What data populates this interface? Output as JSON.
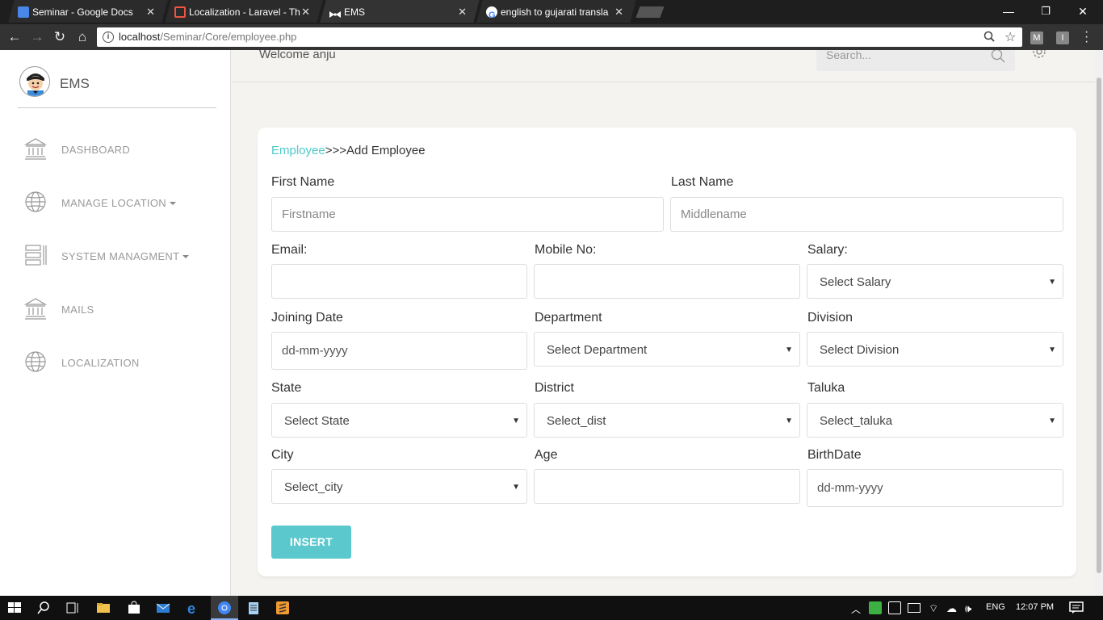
{
  "browser": {
    "tabs": [
      {
        "title": "Seminar - Google Docs",
        "active": false
      },
      {
        "title": "Localization - Laravel - Th",
        "active": false
      },
      {
        "title": "EMS",
        "active": true
      },
      {
        "title": "english to gujarati transla",
        "active": false
      }
    ],
    "url_host": "localhost",
    "url_path": "/Seminar/Core/employee.php",
    "ext1": "M",
    "ext2": "I",
    "min_glyph": "—",
    "max_glyph": "❐",
    "close_glyph": "✕"
  },
  "brand": {
    "name": "EMS"
  },
  "topnav": {
    "welcome": "Welcome anju",
    "search_placeholder": "Search..."
  },
  "sidebar": {
    "items": [
      {
        "label": "DASHBOARD",
        "icon": "bank-icon",
        "has_caret": false
      },
      {
        "label": "MANAGE LOCATION",
        "icon": "globe-icon",
        "has_caret": true
      },
      {
        "label": "SYSTEM MANAGMENT",
        "icon": "list-icon",
        "has_caret": true
      },
      {
        "label": "MAILS",
        "icon": "bank-icon",
        "has_caret": false
      },
      {
        "label": "LOCALIZATION",
        "icon": "globe-icon",
        "has_caret": false
      }
    ]
  },
  "breadcrumb": {
    "link": "Employee",
    "separator": ">>>",
    "current": "Add Employee"
  },
  "form": {
    "first_name": {
      "label": "First Name",
      "placeholder": "Firstname"
    },
    "last_name": {
      "label": "Last Name",
      "placeholder": "Middlename"
    },
    "email": {
      "label": "Email:",
      "placeholder": ""
    },
    "mobile": {
      "label": "Mobile No:",
      "placeholder": ""
    },
    "salary": {
      "label": "Salary:",
      "selected": "Select Salary"
    },
    "joining_date": {
      "label": "Joining Date",
      "placeholder": "dd-mm-yyyy"
    },
    "department": {
      "label": "Department",
      "selected": "Select Department"
    },
    "division": {
      "label": "Division",
      "selected": "Select Division"
    },
    "state": {
      "label": "State",
      "selected": "Select State"
    },
    "district": {
      "label": "District",
      "selected": "Select_dist"
    },
    "taluka": {
      "label": "Taluka",
      "selected": "Select_taluka"
    },
    "city": {
      "label": "City",
      "selected": "Select_city"
    },
    "age": {
      "label": "Age",
      "placeholder": ""
    },
    "birthdate": {
      "label": "BirthDate",
      "placeholder": "dd-mm-yyyy"
    },
    "submit_label": "INSERT"
  },
  "taskbar": {
    "lang": "ENG",
    "time": "12:07 PM"
  },
  "colors": {
    "accent": "#5ac8cd",
    "link": "#4fc9c9"
  }
}
